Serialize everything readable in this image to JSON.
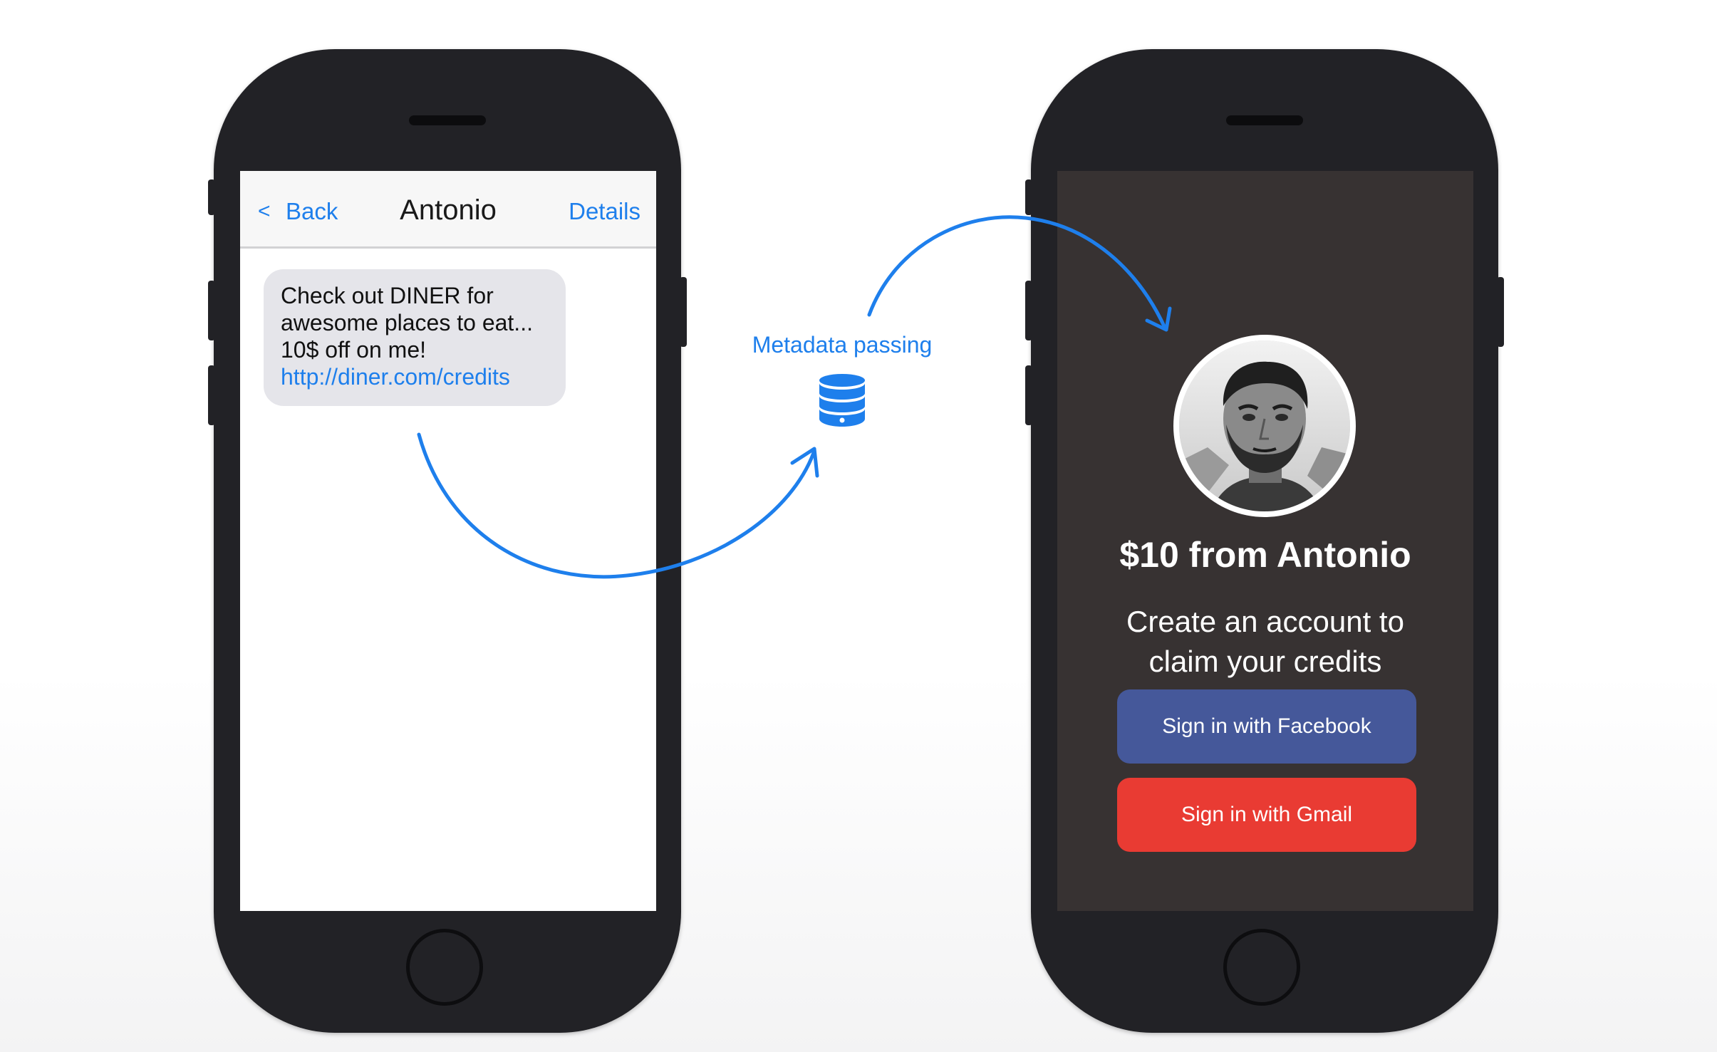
{
  "colors": {
    "accent_blue": "#1e7fec",
    "phone_body": "#222226",
    "claim_screen_bg": "#373232",
    "facebook_blue": "#45589a",
    "gmail_red": "#e93b33",
    "bubble_gray": "#e5e5ea"
  },
  "left_phone": {
    "header": {
      "back_chevron": "<",
      "back_label": "Back",
      "contact_name": "Antonio",
      "details_label": "Details"
    },
    "message": {
      "lines": [
        "Check out DINER for",
        "awesome places to eat...",
        "10$ off on me!"
      ],
      "link": "http://diner.com/credits"
    }
  },
  "flow": {
    "label": "Metadata passing",
    "icon": "database-icon"
  },
  "right_phone": {
    "avatar": "profile-photo",
    "title": "$10 from Antonio",
    "subtitle_lines": [
      "Create an account to",
      "claim your credits"
    ],
    "buttons": {
      "facebook": "Sign in with Facebook",
      "gmail": "Sign in with Gmail"
    }
  }
}
